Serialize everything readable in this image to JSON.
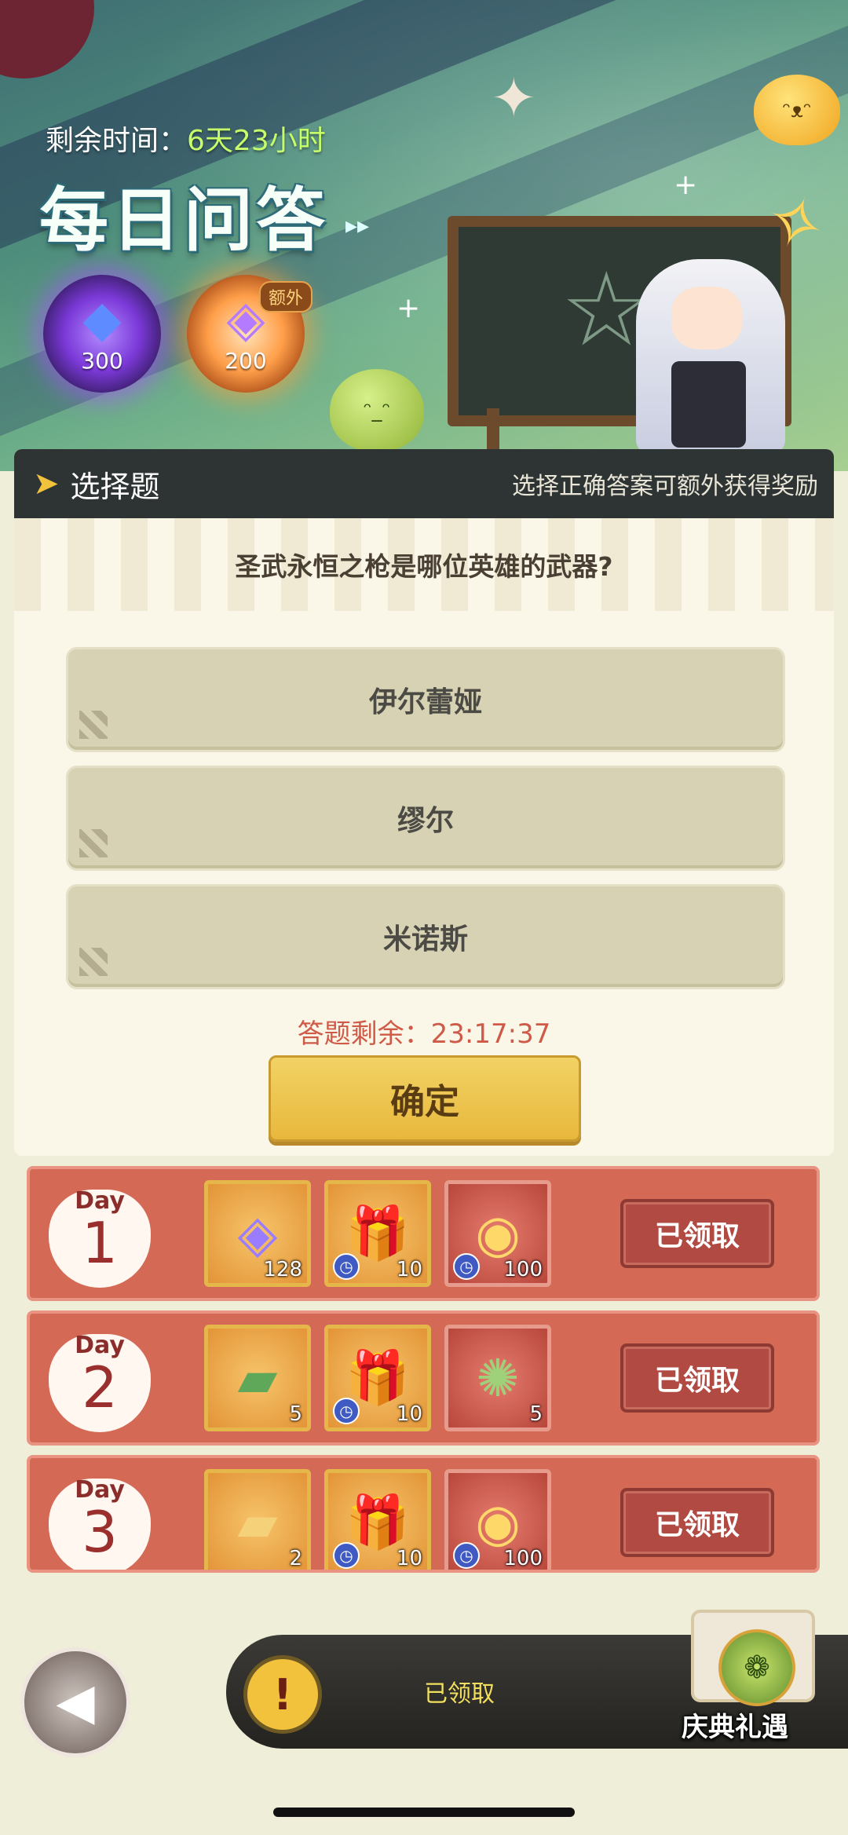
{
  "header": {
    "time_label": "剩余时间：",
    "time_value": "6天23小时",
    "title": "每日问答",
    "rewards": [
      {
        "icon": "blue-crystal-icon",
        "amount": "300"
      },
      {
        "icon": "purple-diamond-icon",
        "amount": "200",
        "badge": "额外"
      }
    ]
  },
  "quiz": {
    "section_label": "选择题",
    "hint": "选择正确答案可额外获得奖励",
    "question": "圣武永恒之枪是哪位英雄的武器?",
    "options": [
      "伊尔蕾娅",
      "缪尔",
      "米诺斯"
    ],
    "countdown_label": "答题剩余：",
    "countdown_value": "23:17:37",
    "confirm_label": "确定"
  },
  "days": [
    {
      "day_word": "Day",
      "day_num": "1",
      "items": [
        {
          "icon": "diamond-icon",
          "qty": "128",
          "timed": false
        },
        {
          "icon": "gift-box-icon",
          "qty": "10",
          "timed": true
        },
        {
          "icon": "bell-medal-icon",
          "qty": "100",
          "timed": true
        }
      ],
      "status": "已领取"
    },
    {
      "day_word": "Day",
      "day_num": "2",
      "items": [
        {
          "icon": "ticket-icon",
          "qty": "5",
          "timed": false
        },
        {
          "icon": "gift-box-icon",
          "qty": "10",
          "timed": true
        },
        {
          "icon": "green-emblem-icon",
          "qty": "5",
          "timed": false
        }
      ],
      "status": "已领取"
    },
    {
      "day_word": "Day",
      "day_num": "3",
      "items": [
        {
          "icon": "gold-ticket-icon",
          "qty": "2",
          "timed": false
        },
        {
          "icon": "gift-box-icon",
          "qty": "10",
          "timed": true
        },
        {
          "icon": "bell-medal-icon",
          "qty": "100",
          "timed": true
        }
      ],
      "status": "已领取"
    }
  ],
  "bottom": {
    "notice_text": "已领取",
    "festival_label": "庆典礼遇"
  },
  "colors": {
    "accent_gold": "#f2c23c",
    "day_row_bg": "#d46a56",
    "countdown_red": "#cf5a48"
  }
}
